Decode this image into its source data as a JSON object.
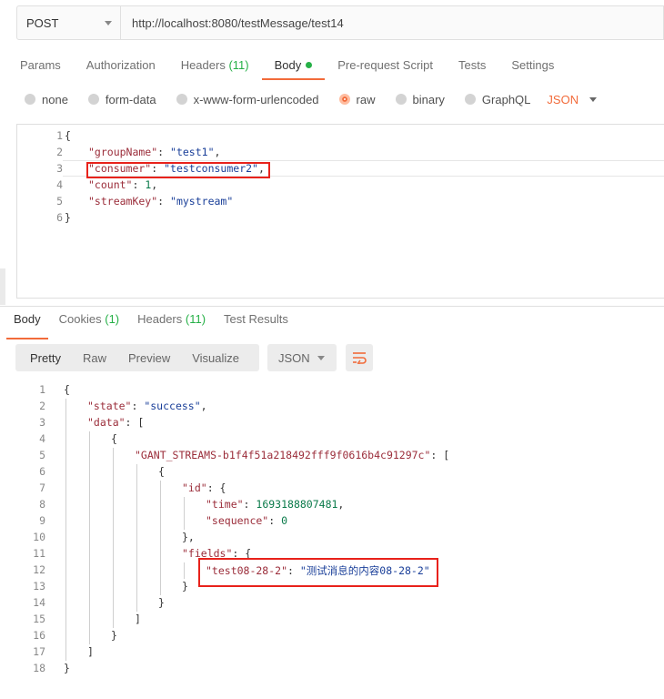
{
  "request": {
    "method": "POST",
    "url": "http://localhost:8080/testMessage/test14"
  },
  "req_tabs": {
    "params": "Params",
    "authorization": "Authorization",
    "headers": "Headers",
    "headers_count": "(11)",
    "body": "Body",
    "prerequest": "Pre-request Script",
    "tests": "Tests",
    "settings": "Settings"
  },
  "body_types": {
    "none": "none",
    "form_data": "form-data",
    "urlencoded": "x-www-form-urlencoded",
    "raw": "raw",
    "binary": "binary",
    "graphql": "GraphQL",
    "language": "JSON"
  },
  "request_body": {
    "line_numbers": [
      "1",
      "2",
      "3",
      "4",
      "5",
      "6"
    ],
    "open": "{",
    "close": "}",
    "groupName_key": "\"groupName\"",
    "groupName_val": "\"test1\"",
    "consumer_key": "\"consumer\"",
    "consumer_val": "\"testconsumer2\"",
    "count_key": "\"count\"",
    "count_val": "1",
    "streamKey_key": "\"streamKey\"",
    "streamKey_val": "\"mystream\""
  },
  "resp_tabs": {
    "body": "Body",
    "cookies": "Cookies",
    "cookies_count": "(1)",
    "headers": "Headers",
    "headers_count": "(11)",
    "test_results": "Test Results"
  },
  "format_bar": {
    "pretty": "Pretty",
    "raw": "Raw",
    "preview": "Preview",
    "visualize": "Visualize",
    "language": "JSON"
  },
  "response_body": {
    "line_numbers": [
      "1",
      "2",
      "3",
      "4",
      "5",
      "6",
      "7",
      "8",
      "9",
      "10",
      "11",
      "12",
      "13",
      "14",
      "15",
      "16",
      "17",
      "18"
    ],
    "state_key": "\"state\"",
    "state_val": "\"success\"",
    "data_key": "\"data\"",
    "stream_key": "\"GANT_STREAMS-b1f4f51a218492fff9f0616b4c91297c\"",
    "id_key": "\"id\"",
    "time_key": "\"time\"",
    "time_val": "1693188807481",
    "sequence_key": "\"sequence\"",
    "sequence_val": "0",
    "fields_key": "\"fields\"",
    "field_key": "\"test08-28-2\"",
    "field_val": "\"测试消息的内容08-28-2\""
  },
  "colors": {
    "accent": "#f26b3a",
    "green": "#26b047",
    "highlight_box": "#e8221b"
  }
}
